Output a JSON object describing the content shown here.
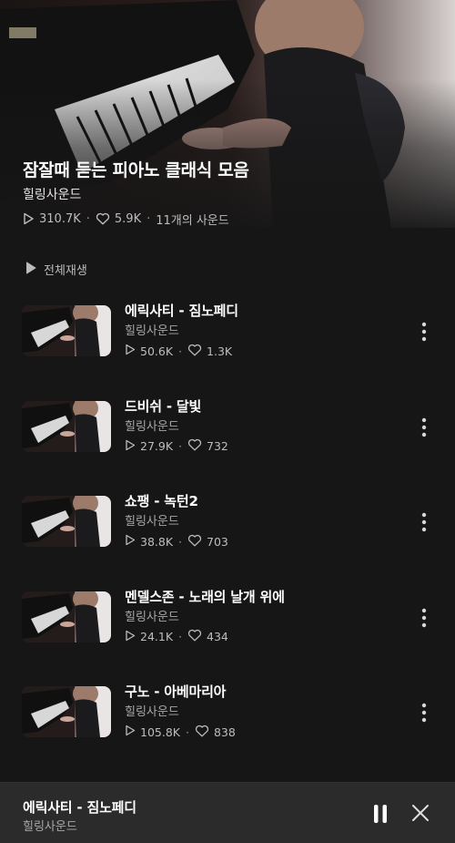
{
  "playlist": {
    "title": "잠잘때 듣는 피아노 클래식 모음",
    "artist": "힐링사운드",
    "plays": "310.7K",
    "likes": "5.9K",
    "track_count": "11개의 사운드"
  },
  "play_all_label": "전체재생",
  "tracks": [
    {
      "title": "에릭사티 - 짐노페디",
      "artist": "힐링사운드",
      "plays": "50.6K",
      "likes": "1.3K"
    },
    {
      "title": "드비쉬 - 달빛",
      "artist": "힐링사운드",
      "plays": "27.9K",
      "likes": "732"
    },
    {
      "title": "쇼팽 - 녹턴2",
      "artist": "힐링사운드",
      "plays": "38.8K",
      "likes": "703"
    },
    {
      "title": "멘델스존 - 노래의 날개 위에",
      "artist": "힐링사운드",
      "plays": "24.1K",
      "likes": "434"
    },
    {
      "title": "구노 - 아베마리아",
      "artist": "힐링사운드",
      "plays": "105.8K",
      "likes": "838"
    }
  ],
  "mini_player": {
    "title": "에릭사티 - 짐노페디",
    "artist": "힐링사운드"
  },
  "colors": {
    "background": "#161616",
    "mini_player": "#2b2b2b",
    "text_primary": "#ffffff",
    "text_secondary": "#a8a8a8"
  },
  "icons": {
    "play": "play-icon",
    "like": "heart-icon",
    "more": "more-vertical-icon",
    "pause": "pause-icon",
    "close": "close-icon"
  }
}
